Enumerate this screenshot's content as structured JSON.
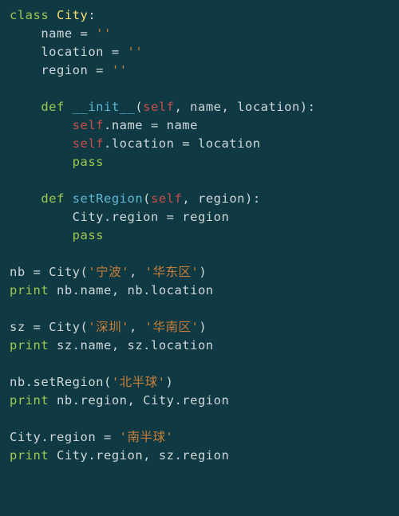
{
  "code": {
    "lines": [
      {
        "indent": 0,
        "tokens": [
          [
            "kw",
            "class"
          ],
          [
            "id",
            " "
          ],
          [
            "cls",
            "City"
          ],
          [
            "id",
            ":"
          ]
        ]
      },
      {
        "indent": 4,
        "tokens": [
          [
            "id",
            "name = "
          ],
          [
            "str",
            "''"
          ]
        ]
      },
      {
        "indent": 4,
        "tokens": [
          [
            "id",
            "location = "
          ],
          [
            "str",
            "''"
          ]
        ]
      },
      {
        "indent": 4,
        "tokens": [
          [
            "id",
            "region = "
          ],
          [
            "str",
            "''"
          ]
        ]
      },
      {
        "indent": 0,
        "tokens": []
      },
      {
        "indent": 4,
        "tokens": [
          [
            "kw",
            "def"
          ],
          [
            "id",
            " "
          ],
          [
            "fn",
            "__init__"
          ],
          [
            "id",
            "("
          ],
          [
            "self",
            "self"
          ],
          [
            "id",
            ", name, location):"
          ]
        ]
      },
      {
        "indent": 8,
        "tokens": [
          [
            "self",
            "self"
          ],
          [
            "id",
            ".name = name"
          ]
        ]
      },
      {
        "indent": 8,
        "tokens": [
          [
            "self",
            "self"
          ],
          [
            "id",
            ".location = location"
          ]
        ]
      },
      {
        "indent": 8,
        "tokens": [
          [
            "kw",
            "pass"
          ]
        ]
      },
      {
        "indent": 0,
        "tokens": []
      },
      {
        "indent": 4,
        "tokens": [
          [
            "kw",
            "def"
          ],
          [
            "id",
            " "
          ],
          [
            "fn",
            "setRegion"
          ],
          [
            "id",
            "("
          ],
          [
            "self",
            "self"
          ],
          [
            "id",
            ", region):"
          ]
        ]
      },
      {
        "indent": 8,
        "tokens": [
          [
            "id",
            "City.region = region"
          ]
        ]
      },
      {
        "indent": 8,
        "tokens": [
          [
            "kw",
            "pass"
          ]
        ]
      },
      {
        "indent": 0,
        "tokens": []
      },
      {
        "indent": 0,
        "tokens": [
          [
            "id",
            "nb = City("
          ],
          [
            "str",
            "'宁波'"
          ],
          [
            "id",
            ", "
          ],
          [
            "str",
            "'华东区'"
          ],
          [
            "id",
            ")"
          ]
        ]
      },
      {
        "indent": 0,
        "tokens": [
          [
            "kw",
            "print"
          ],
          [
            "id",
            " nb.name, nb.location"
          ]
        ]
      },
      {
        "indent": 0,
        "tokens": []
      },
      {
        "indent": 0,
        "tokens": [
          [
            "id",
            "sz = City("
          ],
          [
            "str",
            "'深圳'"
          ],
          [
            "id",
            ", "
          ],
          [
            "str",
            "'华南区'"
          ],
          [
            "id",
            ")"
          ]
        ]
      },
      {
        "indent": 0,
        "tokens": [
          [
            "kw",
            "print"
          ],
          [
            "id",
            " sz.name, sz.location"
          ]
        ]
      },
      {
        "indent": 0,
        "tokens": []
      },
      {
        "indent": 0,
        "tokens": [
          [
            "id",
            "nb.setRegion("
          ],
          [
            "str",
            "'北半球'"
          ],
          [
            "id",
            ")"
          ]
        ]
      },
      {
        "indent": 0,
        "tokens": [
          [
            "kw",
            "print"
          ],
          [
            "id",
            " nb.region, City.region"
          ]
        ]
      },
      {
        "indent": 0,
        "tokens": []
      },
      {
        "indent": 0,
        "tokens": [
          [
            "id",
            "City.region = "
          ],
          [
            "str",
            "'南半球'"
          ]
        ]
      },
      {
        "indent": 0,
        "tokens": [
          [
            "kw",
            "print"
          ],
          [
            "id",
            " City.region, sz.region"
          ]
        ]
      }
    ]
  }
}
